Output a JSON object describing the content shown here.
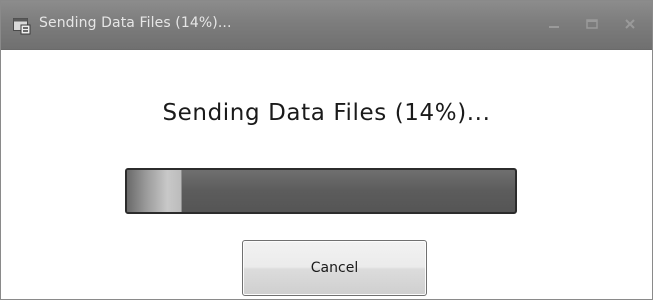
{
  "window": {
    "title": "Sending Data Files (14%)...",
    "icon": "app-window-icon",
    "controls": [
      "minimize-icon",
      "maximize-icon",
      "close-icon"
    ]
  },
  "main": {
    "status_text": "Sending Data Files (14%)...",
    "progress_fraction": 0.14,
    "cancel_label": "Cancel"
  },
  "colors": {
    "titlebar": "#7d7d7d",
    "progress_track": "#5c5c5c",
    "progress_fill": "#c8c8c8"
  }
}
